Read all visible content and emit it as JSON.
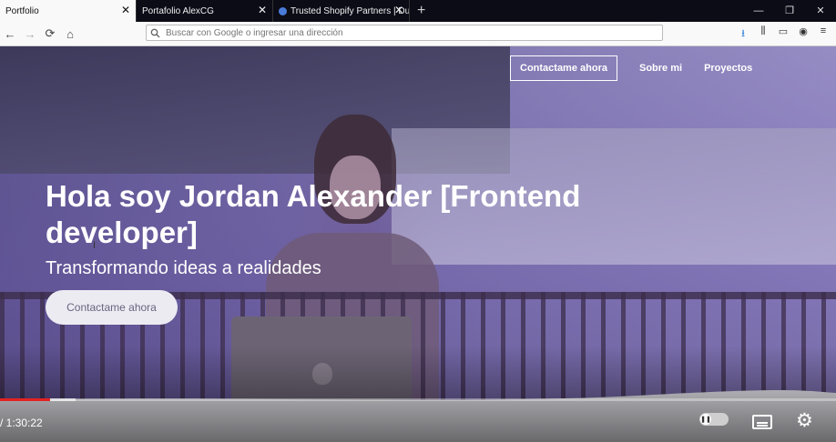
{
  "tabs": [
    {
      "title": "Portfolio",
      "active": true
    },
    {
      "title": "Portafolio AlexCG",
      "active": false
    },
    {
      "title": "Trusted Shopify Partners | Dubli",
      "active": false
    }
  ],
  "address_bar": {
    "placeholder": "Buscar con Google o ingresar una dirección"
  },
  "page": {
    "nav_cta": "Contactame ahora",
    "nav_about": "Sobre mi",
    "nav_projects": "Proyectos",
    "headline": "Hola soy Jordan Alexander [Frontend developer]",
    "subheadline": "Transformando ideas a realidades",
    "hero_button": "Contactame ahora"
  },
  "player": {
    "time": "/ 1:30:22",
    "progress_played_fraction": 0.06,
    "progress_buffered_fraction": 0.09,
    "accent": "#e32222"
  },
  "colors": {
    "overlay": "#7a6cbe"
  }
}
